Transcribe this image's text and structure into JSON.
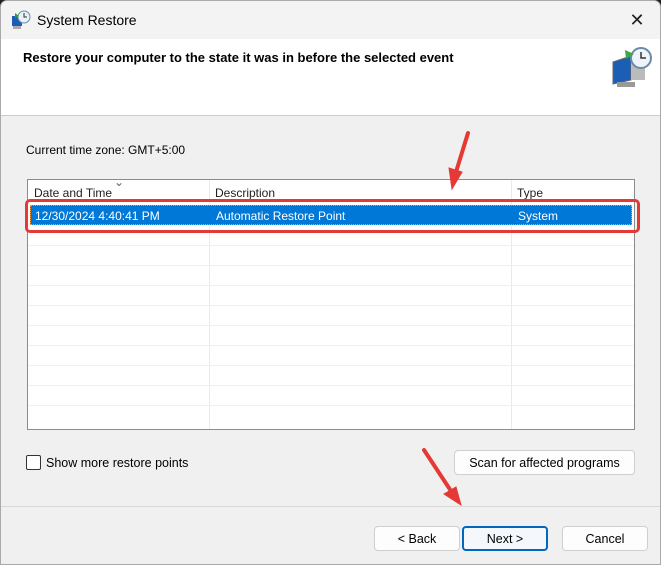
{
  "window": {
    "title": "System Restore"
  },
  "header": {
    "heading": "Restore your computer to the state it was in before the selected event"
  },
  "timezone": "Current time zone: GMT+5:00",
  "table": {
    "columns": [
      "Date and Time",
      "Description",
      "Type"
    ],
    "rows": [
      {
        "date": "12/30/2024 4:40:41 PM",
        "description": "Automatic Restore Point",
        "type": "System",
        "selected": true
      }
    ]
  },
  "show_more_label": "Show more restore points",
  "scan_label": "Scan for affected programs",
  "buttons": {
    "back": "< Back",
    "next": "Next >",
    "cancel": "Cancel"
  },
  "close_glyph": "✕",
  "sort_glyph": "⌄",
  "colors": {
    "selection": "#0078d7",
    "annotation": "#e53935"
  }
}
